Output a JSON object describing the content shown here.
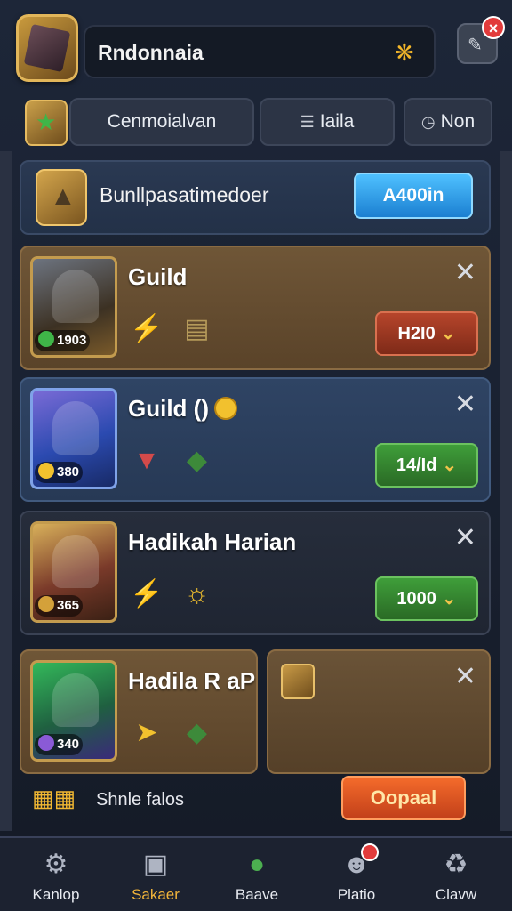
{
  "header": {
    "title": "Rndonnaia",
    "gold_icon": "gold-paw-icon",
    "close_badge": "×"
  },
  "tabs": [
    {
      "label": "Cenmoialvan",
      "icon": "star-shield-icon"
    },
    {
      "label": "Iaila",
      "icon": "card-stack-icon"
    },
    {
      "label": "Non",
      "icon": "clock-icon"
    }
  ],
  "banner": {
    "title": "Bunllpasatimedoer",
    "button": "A400in"
  },
  "cards": [
    {
      "title": "Guild",
      "stat": "1903",
      "button": "H2I0",
      "button_color": "red"
    },
    {
      "title": "Guild ()",
      "stat": "380",
      "button": "14/Id",
      "button_color": "green"
    },
    {
      "title": "Hadikah Harian",
      "stat": "365",
      "button": "1000",
      "button_color": "green"
    },
    {
      "title": "Hadila R aP",
      "stat": "340"
    }
  ],
  "footer": {
    "text": "Shnle falos",
    "button": "Oopaal"
  },
  "nav": [
    {
      "label": "Kanlop",
      "icon": "gear-icon"
    },
    {
      "label": "Sakaer",
      "icon": "crate-icon"
    },
    {
      "label": "Baave",
      "icon": "sword-orb-icon"
    },
    {
      "label": "Platio",
      "icon": "robot-icon"
    },
    {
      "label": "Clavw",
      "icon": "trash-icon"
    }
  ],
  "colors": {
    "accent_blue": "#1b7fd1",
    "accent_orange": "#f46b2b",
    "button_green": "#3f9e3a",
    "button_red": "#b6452b",
    "nav_active": "#f1b43a"
  }
}
